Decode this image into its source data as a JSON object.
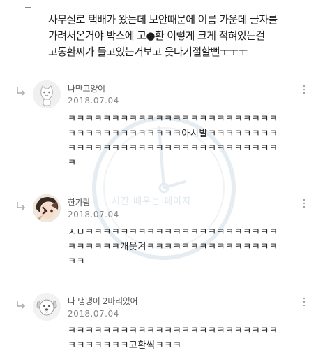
{
  "post": {
    "lines": [
      "사무실로 택배가 왔는데 보안때문에 이름 가운데 글자를",
      "가려서온거야 박스에 고●환 이렇게 크게 적혀있는걸",
      "고동환씨가 들고있는거보고 웃다기절할뻔ㅜㅜㅜ"
    ]
  },
  "watermark": {
    "text": "시간 때우는 페이지"
  },
  "comments": [
    {
      "nickname": "나만고양이",
      "date": "2018.07.04",
      "avatar_icon": "cat-face-avatar",
      "lines": [
        "ㅋㅋㅋㅋㅋㅋㅋㅋㅋㅋㅋㅋㅋㅋㅋㅋㅋㅋㅋㅋㅋㅋㅋㅋ",
        "ㅋㅋㅋㅋㅋㅋㅋㅋㅋㅋㅋㅋㅋ아시발ㅋㅋㅋㅋㅋㅋㅋㅋ",
        "ㅋㅋㅋㅋㅋㅋㅋㅋㅋㅋㅋㅋㅋㅋㅋㅋㅋㅋㅋㅋㅋㅋㅋㅋ",
        "ㅋ"
      ]
    },
    {
      "nickname": "한가람",
      "date": "2018.07.04",
      "avatar_icon": "anime-character-avatar",
      "lines": [
        "ㅅㅂㅋㅋㅋㅋㅋㅋㅋㅋㅋㅋㅋㅋㅋㅋㅋㅋㅋㅋㅋㅋㅋㅋ",
        "ㅋㅋㅋㅋㅋㅋ개웃겨ㅋㅋㅋㅋㅋㅋㅋㅋㅋㅋㅋㅋㅋㅋㅋ",
        "ㅋㅋ"
      ]
    },
    {
      "nickname": "나 댕댕이 2마리있어",
      "date": "2018.07.04",
      "avatar_icon": "dog-avatar",
      "lines": [
        "ㅋㅋㅋㅋㅋㅋㅋㅋㅋㅋㅋㅋㅋㅋㅋㅋㅋㅋㅋㅋㅋㅋㅋㅋ",
        "ㅋㅋㅋㅋㅋㅋㅋ고환씩ㅋㅋㅋ"
      ]
    }
  ],
  "colors": {
    "text": "#222222",
    "meta": "#888888",
    "watermark": "#e6edf2"
  }
}
